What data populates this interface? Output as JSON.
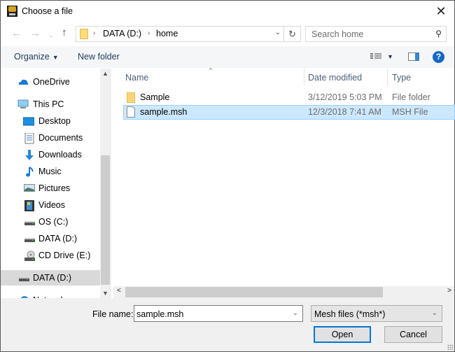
{
  "window": {
    "title": "Choose a file",
    "close_icon": "close-icon"
  },
  "nav": {
    "back_icon": "arrow-left-icon",
    "forward_icon": "arrow-right-icon",
    "recent_icon": "chevron-down-icon",
    "up_icon": "arrow-up-icon"
  },
  "address": {
    "crumbs": [
      "DATA (D:)",
      "home"
    ],
    "refresh_icon": "refresh-icon"
  },
  "search": {
    "placeholder": "Search home",
    "icon": "search-icon"
  },
  "toolbar": {
    "organize_label": "Organize",
    "new_folder_label": "New folder",
    "help_label": "?"
  },
  "sidebar": {
    "items": [
      {
        "label": "OneDrive",
        "icon": "onedrive-icon"
      },
      {
        "label": "This PC",
        "icon": "computer-icon"
      },
      {
        "label": "Desktop",
        "icon": "desktop-icon"
      },
      {
        "label": "Documents",
        "icon": "documents-icon"
      },
      {
        "label": "Downloads",
        "icon": "downloads-icon"
      },
      {
        "label": "Music",
        "icon": "music-icon"
      },
      {
        "label": "Pictures",
        "icon": "pictures-icon"
      },
      {
        "label": "Videos",
        "icon": "videos-icon"
      },
      {
        "label": "OS (C:)",
        "icon": "drive-icon"
      },
      {
        "label": "DATA (D:)",
        "icon": "drive-icon"
      },
      {
        "label": "CD Drive (E:)",
        "icon": "cd-drive-icon"
      },
      {
        "label": "DATA (D:)",
        "icon": "drive-icon",
        "selected": true
      },
      {
        "label": "Network",
        "icon": "network-icon"
      }
    ]
  },
  "filelist": {
    "columns": [
      "Name",
      "Date modified",
      "Type"
    ],
    "rows": [
      {
        "name": "Sample",
        "date": "3/12/2019 5:03 PM",
        "type": "File folder",
        "icon": "folder-icon"
      },
      {
        "name": "sample.msh",
        "date": "12/3/2018 7:41 AM",
        "type": "MSH File",
        "icon": "file-icon",
        "selected": true
      }
    ]
  },
  "footer": {
    "file_name_label": "File name:",
    "file_name_value": "sample.msh",
    "file_type_value": "Mesh files (*msh*)",
    "open_label": "Open",
    "cancel_label": "Cancel"
  }
}
